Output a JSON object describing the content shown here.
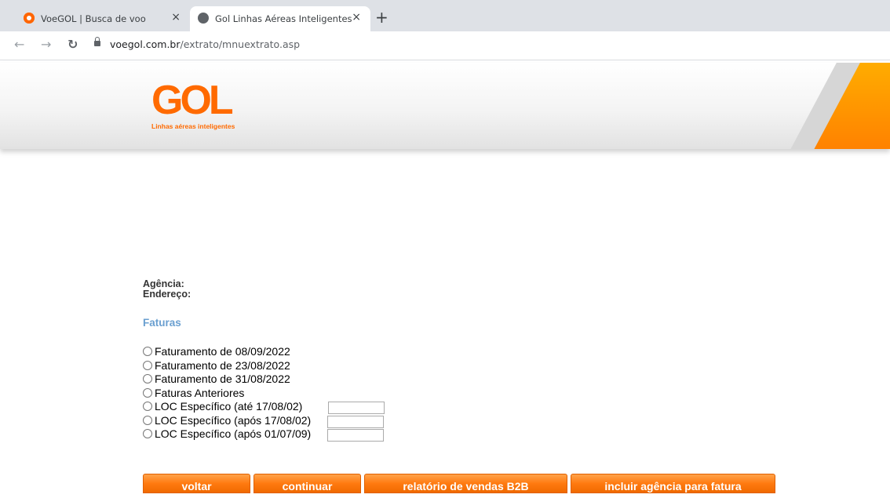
{
  "browser": {
    "tabs": [
      {
        "title": "VoeGOL | Busca de voo",
        "active": false
      },
      {
        "title": "Gol Linhas Aéreas Inteligentes",
        "active": true
      }
    ],
    "close_glyph": "×",
    "new_tab_glyph": "+",
    "url_host": "voegol.com.br",
    "url_path": "/extrato/mnuextrato.asp"
  },
  "header": {
    "logo": "GOL",
    "tagline": "Linhas aéreas inteligentes"
  },
  "info": {
    "agencia_label": "Agência:",
    "endereco_label": "Endereço:"
  },
  "section_title": "Faturas",
  "options": [
    {
      "label": "Faturamento de 08/09/2022"
    },
    {
      "label": "Faturamento de 23/08/2022"
    },
    {
      "label": "Faturamento de 31/08/2022"
    },
    {
      "label": "Faturas Anteriores"
    },
    {
      "label": "LOC Específico (até 17/08/02)"
    },
    {
      "label": "LOC Específico (após 17/08/02)"
    },
    {
      "label": "LOC Específico (após 01/07/09)"
    }
  ],
  "buttons": {
    "voltar": "voltar",
    "continuar": "continuar",
    "relatorio": "relatório de vendas B2B",
    "incluir": "incluir agência para fatura"
  },
  "colors": {
    "brand_orange": "#ff6a00",
    "section_blue": "#6a9fd0"
  }
}
